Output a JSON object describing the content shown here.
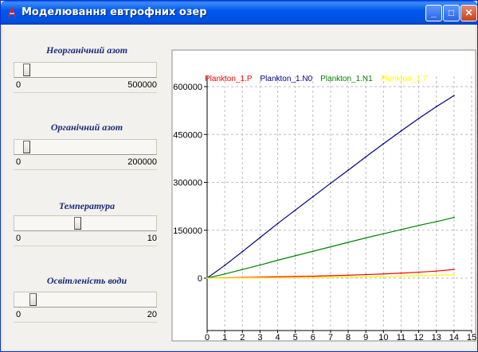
{
  "window": {
    "title": "Моделювання евтрофних озер",
    "minimize_label": "_",
    "maximize_label": "□",
    "close_label": "✕"
  },
  "sliders": [
    {
      "label": "Неорганічний азот",
      "min": "0",
      "max": "500000",
      "value_fraction": 0.05
    },
    {
      "label": "Органічний азот",
      "min": "0",
      "max": "200000",
      "value_fraction": 0.05
    },
    {
      "label": "Температура",
      "min": "0",
      "max": "10",
      "value_fraction": 0.45
    },
    {
      "label": "Освітленість води",
      "min": "0",
      "max": "20",
      "value_fraction": 0.1
    }
  ],
  "colors": {
    "title_bar": "#0058ee",
    "series_p": "#ff0000",
    "series_n0": "#000080",
    "series_n1": "#008000",
    "series_7": "#ffff00"
  },
  "chart_data": {
    "type": "line",
    "grid": true,
    "legend_position": "top",
    "xlim": [
      0,
      15
    ],
    "ylim": [
      0,
      600000
    ],
    "x_ticks": [
      "0",
      "1",
      "2",
      "3",
      "4",
      "5",
      "6",
      "7",
      "8",
      "9",
      "10",
      "11",
      "12",
      "13",
      "14",
      "15"
    ],
    "y_ticks": [
      "0",
      "150000",
      "300000",
      "450000",
      "600000"
    ],
    "x": [
      0,
      1,
      2,
      3,
      4,
      5,
      6,
      7,
      8,
      9,
      10,
      11,
      12,
      13,
      14
    ],
    "series": [
      {
        "name": "Plankton_1.P",
        "color": "#ff0000",
        "values": [
          0,
          1000,
          2000,
          3000,
          4000,
          5000,
          6000,
          7500,
          9000,
          11000,
          13000,
          15500,
          18500,
          22000,
          27000
        ]
      },
      {
        "name": "Plankton_1.N0",
        "color": "#000080",
        "values": [
          0,
          40000,
          83000,
          127000,
          171000,
          213000,
          255000,
          297000,
          338000,
          380000,
          421000,
          461000,
          500000,
          537000,
          572000
        ]
      },
      {
        "name": "Plankton_1.N1",
        "color": "#008000",
        "values": [
          0,
          13000,
          27000,
          41000,
          56000,
          70000,
          84000,
          98000,
          112000,
          126000,
          139000,
          152000,
          165000,
          177000,
          190000
        ]
      },
      {
        "name": "Plankton_1.7",
        "color": "#ffff00",
        "values": [
          0,
          200,
          400,
          700,
          1000,
          1400,
          1900,
          2500,
          3200,
          4000,
          5000,
          6200,
          7500,
          9000,
          10500
        ]
      }
    ]
  }
}
